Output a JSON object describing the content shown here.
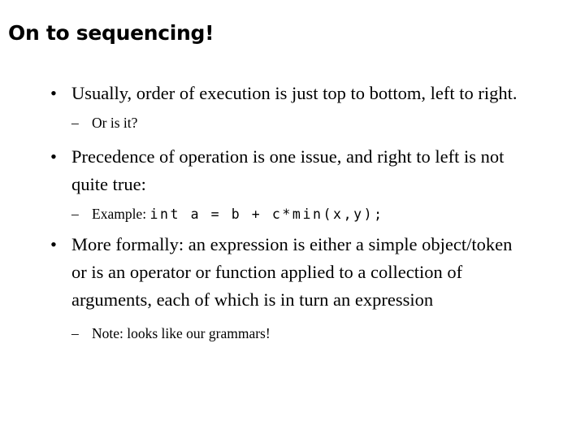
{
  "slide": {
    "title": "On to sequencing!",
    "background_color": "#ffffff",
    "text_color": "#000000",
    "bullet_marker_level1": "•",
    "bullet_marker_level2": "–",
    "content": {
      "b1": {
        "text": "Usually, order of execution is just top to bottom, left to right."
      },
      "b1s1": {
        "text": "Or is it?"
      },
      "b2": {
        "text": "Precedence of operation is one issue, and right to left is not quite true:"
      },
      "b2s1": {
        "label": "Example: ",
        "code": "int a = b + c*min(x,y);"
      },
      "b3": {
        "text": "More formally: an expression is either a simple object/token or is an operator or function applied to a collection of arguments, each of which is in turn an expression"
      },
      "b3s1": {
        "text": "Note: looks like our grammars!"
      }
    }
  }
}
